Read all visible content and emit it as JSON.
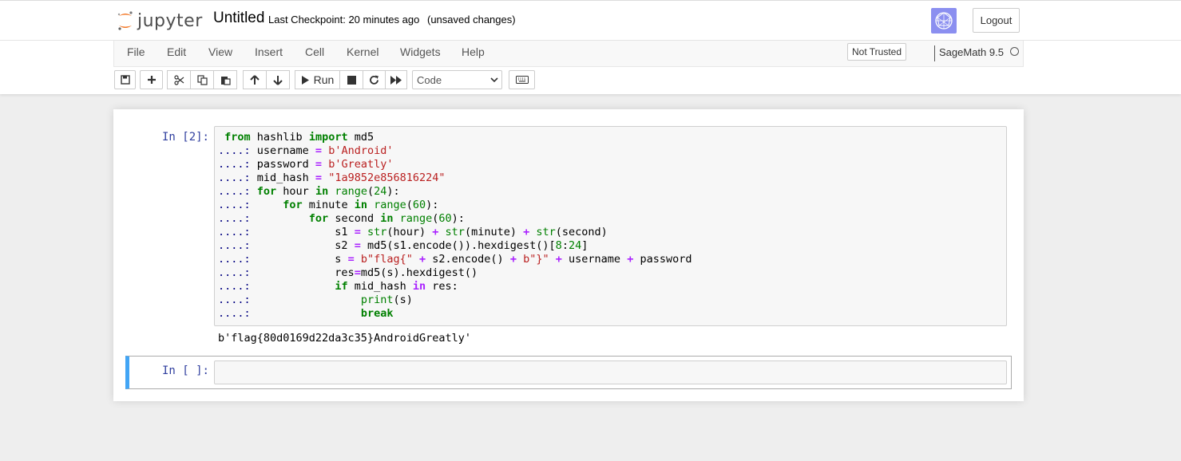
{
  "header": {
    "logo_text": "jupyter",
    "notebook_name": "Untitled",
    "checkpoint": "Last Checkpoint: 20 minutes ago",
    "autosave_status": "(unsaved changes)",
    "logout_label": "Logout",
    "kernel_logo_icon": "sagemath-logo-icon"
  },
  "menubar": {
    "items": [
      "File",
      "Edit",
      "View",
      "Insert",
      "Cell",
      "Kernel",
      "Widgets",
      "Help"
    ],
    "trust_label": "Not Trusted",
    "kernel_name": "SageMath 9.5",
    "kernel_indicator_icon": "kernel-idle-circle-icon"
  },
  "toolbar": {
    "run_label": "Run",
    "cell_type": "Code",
    "icons": [
      "save-icon",
      "plus-icon",
      "cut-icon",
      "copy-icon",
      "paste-icon",
      "arrow-up-icon",
      "arrow-down-icon",
      "play-icon",
      "stop-icon",
      "restart-icon",
      "fast-forward-icon",
      "keyboard-icon"
    ]
  },
  "cells": [
    {
      "prompt": "In [2]:",
      "code_lines": [
        " from hashlib import md5",
        "....: username = b'Android'",
        "....: password = b'Greatly'",
        "....: mid_hash = \"1a9852e856816224\"",
        "....: for hour in range(24):",
        "....:     for minute in range(60):",
        "....:         for second in range(60):",
        "....:             s1 = str(hour) + str(minute) + str(second)",
        "....:             s2 = md5(s1.encode()).hexdigest()[8:24]",
        "....:             s = b\"flag{\" + s2.encode() + b\"}\" + username + password",
        "....:             res=md5(s).hexdigest()",
        "....:             if mid_hash in res:",
        "....:                 print(s)",
        "....:                 break"
      ],
      "output": "b'flag{80d0169d22da3c35}AndroidGreatly'"
    },
    {
      "prompt": "In [ ]:",
      "code_lines": []
    }
  ],
  "colors": {
    "prompt": "#303f9f",
    "keyword": "#008000",
    "operator": "#aa22ff",
    "string": "#ba2121",
    "selected_cell_border": "#42a5f5"
  }
}
